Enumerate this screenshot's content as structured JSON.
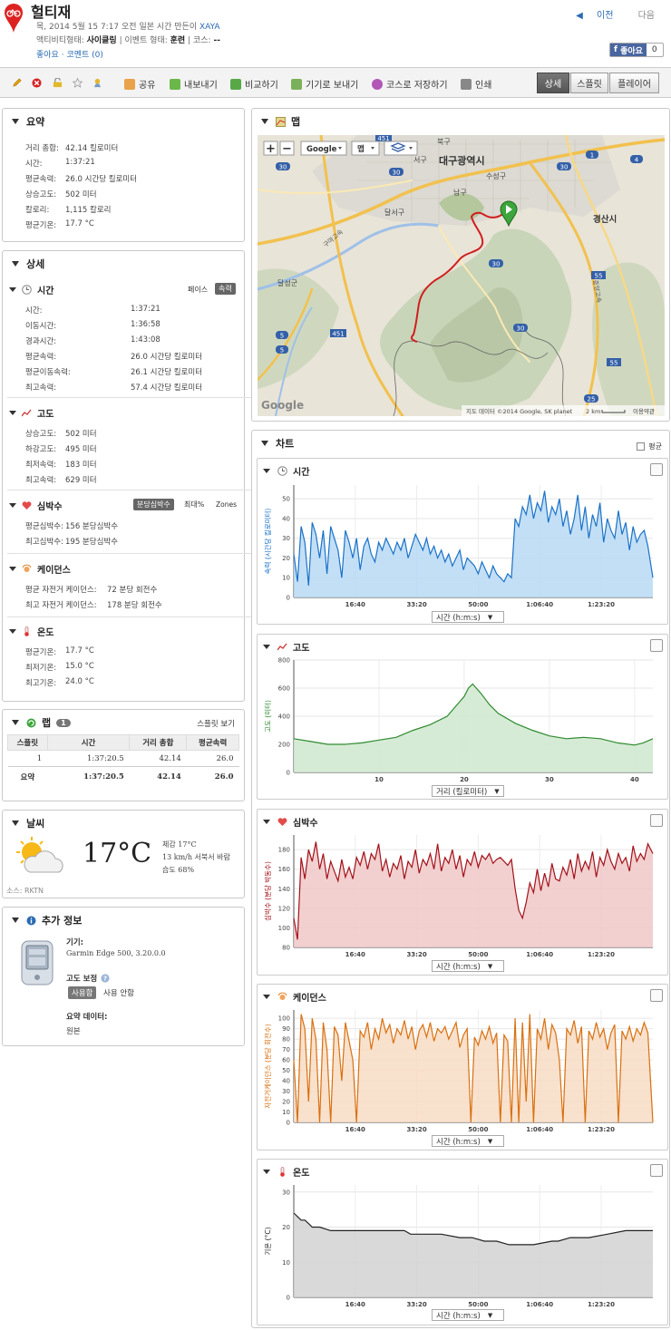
{
  "header": {
    "title": "헐티재",
    "meta_line": "목, 2014 5월 15 7:17 오전 일본 시간 만든이",
    "author": "XAYA",
    "activity_type_label": "액티비티형태:",
    "activity_type": "사이클링",
    "event_type_label": "이벤트 형태:",
    "event_type": "훈련",
    "course_label": "코스:",
    "course_value": "--",
    "like_link": "좋아요",
    "comment_link": "코멘트 (0)",
    "prev": "이전",
    "next": "다음",
    "fb_like": "좋아요",
    "fb_count": "0"
  },
  "toolbar": {
    "share": "공유",
    "export": "내보내기",
    "compare": "비교하기",
    "send_device": "기기로 보내기",
    "save_course": "코스로 저장하기",
    "print": "인쇄",
    "view_detail": "상세",
    "view_splits": "스플릿",
    "view_player": "플레이어"
  },
  "summary": {
    "title": "요약",
    "rows": [
      {
        "label": "거리 총합:",
        "value": "42.14 킬로미터"
      },
      {
        "label": "시간:",
        "value": "1:37:21"
      },
      {
        "label": "평균속력:",
        "value": "26.0 시간당 킬로미터"
      },
      {
        "label": "상승고도:",
        "value": "502 미터"
      },
      {
        "label": "칼로리:",
        "value": "1,115 칼로리"
      },
      {
        "label": "평균기온:",
        "value": "17.7 °C"
      }
    ]
  },
  "details": {
    "title": "상세",
    "time": {
      "title": "시간",
      "toggle_pace": "페이스",
      "toggle_speed": "속력",
      "rows": [
        {
          "label": "시간:",
          "value": "1:37:21"
        },
        {
          "label": "이동시간:",
          "value": "1:36:58"
        },
        {
          "label": "경과시간:",
          "value": "1:43:08"
        },
        {
          "label": "평균속력:",
          "value": "26.0 시간당 킬로미터"
        },
        {
          "label": "평균이동속력:",
          "value": "26.1 시간당 킬로미터"
        },
        {
          "label": "최고속력:",
          "value": "57.4 시간당 킬로미터"
        }
      ]
    },
    "elevation": {
      "title": "고도",
      "rows": [
        {
          "label": "상승고도:",
          "value": "502 미터"
        },
        {
          "label": "하강고도:",
          "value": "495 미터"
        },
        {
          "label": "최저속력:",
          "value": "183 미터"
        },
        {
          "label": "최고속력:",
          "value": "629 미터"
        }
      ]
    },
    "heart": {
      "title": "심박수",
      "toggle_bpm": "분당심박수",
      "toggle_max": "최대%",
      "toggle_zones": "Zones",
      "rows": [
        {
          "label": "평균심박수:",
          "value": "156 분당심박수"
        },
        {
          "label": "최고심박수:",
          "value": "195 분당심박수"
        }
      ]
    },
    "cadence": {
      "title": "케이던스",
      "rows": [
        {
          "label": "평균 자전거 케이던스:",
          "value": "72 분당 회전수"
        },
        {
          "label": "최고 자전거 케이던스:",
          "value": "178 분당 회전수"
        }
      ]
    },
    "temperature": {
      "title": "온도",
      "rows": [
        {
          "label": "평균기온:",
          "value": "17.7 °C"
        },
        {
          "label": "최저기온:",
          "value": "15.0 °C"
        },
        {
          "label": "최고기온:",
          "value": "24.0 °C"
        }
      ]
    }
  },
  "laps": {
    "title": "랩",
    "count": "1",
    "view_splits": "스플릿 보기",
    "headers": [
      "스플릿",
      "시간",
      "거리 총합",
      "평균속력"
    ],
    "rows": [
      [
        "1",
        "1:37:20.5",
        "42.14",
        "26.0"
      ]
    ],
    "summary": [
      "요약",
      "1:37:20.5",
      "42.14",
      "26.0"
    ]
  },
  "weather": {
    "title": "날씨",
    "temp": "17°C",
    "feels": "체감 17°C",
    "wind": "13 km/h 서북서 바람",
    "humidity": "습도 68%",
    "source": "소스: RKTN"
  },
  "extra": {
    "title": "추가 정보",
    "device_label": "기기:",
    "device": "Garmin Edge 500, 3.20.0.0",
    "elev_corr_label": "고도 보정",
    "elev_on": "사용함",
    "elev_off": "사용 안함",
    "summary_data_label": "요약 데이터:",
    "summary_data": "원본"
  },
  "map": {
    "title": "맵",
    "zoom_in": "+",
    "zoom_out": "−",
    "google_btn": "Google",
    "map_btn": "맵",
    "city": "대구광역시",
    "city2": "경산시",
    "labels": [
      "북구",
      "서구",
      "남구",
      "수성구",
      "달서구",
      "달성군",
      "구마고속",
      "중앙고속"
    ],
    "road_numbers": [
      "451",
      "30",
      "30",
      "30",
      "30",
      "5",
      "451",
      "30",
      "55",
      "55",
      "25",
      "4",
      "1",
      "5"
    ],
    "attribution": "지도 데이터 ©2014 Google, SK planet",
    "scale": "2 km",
    "terms": "이용약관",
    "google_logo": "Google"
  },
  "charts": {
    "title": "차트",
    "avg_label": "평균",
    "speed": {
      "title": "시간",
      "select": "시간 (h:m:s)"
    },
    "elevation": {
      "title": "고도",
      "select": "거리 (킬로미터)"
    },
    "heart": {
      "title": "심박수",
      "select": "시간 (h:m:s)"
    },
    "cadence": {
      "title": "케이던스",
      "select": "시간 (h:m:s)"
    },
    "temperature": {
      "title": "온도",
      "select": "시간 (h:m:s)"
    }
  },
  "chart_data": [
    {
      "type": "area",
      "id": "speed",
      "ylabel": "속력 (시간당 킬로미터)",
      "xlabel": "",
      "x_ticks": [
        "16:40",
        "33:20",
        "50:00",
        "1:06:40",
        "1:23:20"
      ],
      "x_tick_values": [
        1000,
        2000,
        3000,
        4000,
        5000
      ],
      "xlim": [
        0,
        5841
      ],
      "ylim": [
        0,
        57
      ],
      "y_ticks": [
        0,
        10,
        20,
        30,
        40,
        50
      ],
      "color": "#1a72c8",
      "fill": "#b9d9f5",
      "x": [
        0,
        60,
        120,
        180,
        240,
        300,
        360,
        420,
        480,
        540,
        600,
        660,
        720,
        780,
        840,
        900,
        960,
        1020,
        1080,
        1140,
        1200,
        1260,
        1320,
        1380,
        1440,
        1500,
        1560,
        1620,
        1680,
        1740,
        1800,
        1860,
        1920,
        1980,
        2040,
        2100,
        2160,
        2220,
        2280,
        2340,
        2400,
        2460,
        2520,
        2580,
        2640,
        2700,
        2760,
        2820,
        2880,
        2940,
        3000,
        3060,
        3120,
        3180,
        3240,
        3300,
        3360,
        3420,
        3480,
        3540,
        3600,
        3660,
        3720,
        3780,
        3840,
        3900,
        3960,
        4020,
        4080,
        4140,
        4200,
        4260,
        4320,
        4380,
        4440,
        4500,
        4560,
        4620,
        4680,
        4740,
        4800,
        4860,
        4920,
        4980,
        5040,
        5100,
        5160,
        5220,
        5280,
        5340,
        5400,
        5460,
        5520,
        5580,
        5640,
        5700,
        5760,
        5841
      ],
      "values": [
        22,
        8,
        36,
        28,
        6,
        38,
        32,
        20,
        34,
        12,
        36,
        30,
        24,
        10,
        34,
        28,
        20,
        30,
        14,
        26,
        30,
        22,
        18,
        28,
        24,
        30,
        26,
        22,
        28,
        24,
        30,
        20,
        26,
        32,
        28,
        24,
        30,
        22,
        26,
        20,
        24,
        18,
        22,
        16,
        20,
        24,
        14,
        20,
        18,
        16,
        12,
        18,
        14,
        10,
        16,
        12,
        10,
        8,
        12,
        10,
        40,
        36,
        46,
        42,
        52,
        40,
        48,
        44,
        54,
        38,
        46,
        42,
        50,
        36,
        44,
        32,
        40,
        52,
        34,
        46,
        30,
        42,
        36,
        48,
        28,
        40,
        34,
        30,
        44,
        32,
        38,
        24,
        36,
        28,
        32,
        34,
        26,
        10
      ]
    },
    {
      "type": "area",
      "id": "elevation",
      "ylabel": "고도 (미터)",
      "xlabel": "",
      "x_ticks": [
        "10",
        "20",
        "30",
        "40"
      ],
      "x_tick_values": [
        10,
        20,
        30,
        40
      ],
      "xlim": [
        0,
        42.14
      ],
      "ylim": [
        0,
        800
      ],
      "y_ticks": [
        0,
        200,
        400,
        600,
        800
      ],
      "color": "#2e8b2e",
      "fill": "#cfe8cf",
      "x": [
        0,
        2,
        4,
        6,
        8,
        10,
        12,
        14,
        16,
        18,
        19,
        20,
        20.5,
        21,
        22,
        23,
        24,
        26,
        28,
        30,
        32,
        34,
        36,
        38,
        40,
        41,
        42.14
      ],
      "values": [
        240,
        220,
        200,
        200,
        210,
        230,
        250,
        300,
        340,
        400,
        470,
        540,
        600,
        629,
        560,
        480,
        420,
        350,
        300,
        260,
        240,
        250,
        240,
        210,
        195,
        210,
        240
      ]
    },
    {
      "type": "area",
      "id": "heart",
      "ylabel": "심박수 (분당 박동수)",
      "xlabel": "",
      "x_ticks": [
        "16:40",
        "33:20",
        "50:00",
        "1:06:40",
        "1:23:20"
      ],
      "x_tick_values": [
        1000,
        2000,
        3000,
        4000,
        5000
      ],
      "xlim": [
        0,
        5841
      ],
      "ylim": [
        80,
        195
      ],
      "y_ticks": [
        80,
        100,
        120,
        140,
        160,
        180
      ],
      "color": "#a3111a",
      "fill": "#f0c8c8",
      "x": [
        0,
        60,
        120,
        180,
        240,
        300,
        360,
        420,
        480,
        540,
        600,
        660,
        720,
        780,
        840,
        900,
        960,
        1020,
        1080,
        1140,
        1200,
        1260,
        1320,
        1380,
        1440,
        1500,
        1560,
        1620,
        1680,
        1740,
        1800,
        1860,
        1920,
        1980,
        2040,
        2100,
        2160,
        2220,
        2280,
        2340,
        2400,
        2460,
        2520,
        2580,
        2640,
        2700,
        2760,
        2820,
        2880,
        2940,
        3000,
        3060,
        3120,
        3180,
        3240,
        3300,
        3360,
        3420,
        3480,
        3540,
        3600,
        3660,
        3720,
        3780,
        3840,
        3900,
        3960,
        4020,
        4080,
        4140,
        4200,
        4260,
        4320,
        4380,
        4440,
        4500,
        4560,
        4620,
        4680,
        4740,
        4800,
        4860,
        4920,
        4980,
        5040,
        5100,
        5160,
        5220,
        5280,
        5340,
        5400,
        5460,
        5520,
        5580,
        5640,
        5700,
        5760,
        5841
      ],
      "values": [
        110,
        88,
        172,
        150,
        180,
        168,
        188,
        160,
        176,
        150,
        168,
        158,
        148,
        170,
        152,
        162,
        150,
        172,
        164,
        178,
        160,
        176,
        170,
        186,
        158,
        170,
        152,
        166,
        160,
        174,
        150,
        168,
        162,
        180,
        156,
        170,
        164,
        176,
        160,
        186,
        158,
        172,
        166,
        180,
        160,
        174,
        152,
        170,
        164,
        178,
        162,
        174,
        170,
        176,
        166,
        170,
        172,
        168,
        164,
        170,
        140,
        118,
        110,
        126,
        146,
        136,
        160,
        138,
        156,
        142,
        166,
        150,
        148,
        162,
        154,
        170,
        150,
        176,
        158,
        168,
        160,
        178,
        152,
        172,
        164,
        180,
        168,
        160,
        176,
        166,
        172,
        158,
        184,
        168,
        176,
        170,
        186,
        176
      ]
    },
    {
      "type": "area",
      "id": "cadence",
      "ylabel": "자전거케이던스 (분당 회전수)",
      "xlabel": "",
      "x_ticks": [
        "16:40",
        "33:20",
        "50:00",
        "1:06:40",
        "1:23:20"
      ],
      "x_tick_values": [
        1000,
        2000,
        3000,
        4000,
        5000
      ],
      "xlim": [
        0,
        5841
      ],
      "ylim": [
        0,
        108
      ],
      "y_ticks": [
        0,
        10,
        20,
        30,
        40,
        50,
        60,
        70,
        80,
        90,
        100
      ],
      "color": "#d9700f",
      "fill": "#f7dcc4",
      "x": [
        0,
        60,
        120,
        180,
        240,
        300,
        360,
        420,
        480,
        540,
        600,
        660,
        720,
        780,
        840,
        900,
        960,
        1020,
        1080,
        1140,
        1200,
        1260,
        1320,
        1380,
        1440,
        1500,
        1560,
        1620,
        1680,
        1740,
        1800,
        1860,
        1920,
        1980,
        2040,
        2100,
        2160,
        2220,
        2280,
        2340,
        2400,
        2460,
        2520,
        2580,
        2640,
        2700,
        2760,
        2820,
        2880,
        2940,
        3000,
        3060,
        3120,
        3180,
        3240,
        3300,
        3360,
        3420,
        3480,
        3540,
        3600,
        3660,
        3720,
        3780,
        3840,
        3900,
        3960,
        4020,
        4080,
        4140,
        4200,
        4260,
        4320,
        4380,
        4440,
        4500,
        4560,
        4620,
        4680,
        4740,
        4800,
        4860,
        4920,
        4980,
        5040,
        5100,
        5160,
        5220,
        5280,
        5340,
        5400,
        5460,
        5520,
        5580,
        5640,
        5700,
        5760,
        5841
      ],
      "values": [
        60,
        0,
        104,
        90,
        20,
        100,
        80,
        0,
        96,
        70,
        0,
        92,
        84,
        40,
        96,
        78,
        60,
        0,
        88,
        82,
        96,
        70,
        90,
        80,
        100,
        86,
        94,
        76,
        90,
        84,
        98,
        80,
        92,
        70,
        88,
        94,
        82,
        96,
        78,
        90,
        86,
        92,
        80,
        88,
        96,
        72,
        84,
        90,
        0,
        82,
        74,
        88,
        80,
        92,
        76,
        86,
        0,
        84,
        78,
        0,
        100,
        0,
        96,
        20,
        104,
        0,
        90,
        80,
        100,
        70,
        94,
        86,
        60,
        0,
        90,
        84,
        98,
        76,
        92,
        0,
        88,
        80,
        96,
        82,
        90,
        70,
        86,
        94,
        0,
        88,
        80,
        92,
        78,
        90,
        84,
        96,
        86,
        0
      ]
    },
    {
      "type": "area",
      "id": "temperature",
      "ylabel": "기온 (°C)",
      "xlabel": "",
      "x_ticks": [
        "16:40",
        "33:20",
        "50:00",
        "1:06:40",
        "1:23:20"
      ],
      "x_tick_values": [
        1000,
        2000,
        3000,
        4000,
        5000
      ],
      "xlim": [
        0,
        5841
      ],
      "ylim": [
        0,
        32
      ],
      "y_ticks": [
        0,
        10,
        20,
        30
      ],
      "color": "#222222",
      "fill": "#d2d2d2",
      "x": [
        0,
        60,
        120,
        180,
        240,
        300,
        420,
        600,
        900,
        1200,
        1500,
        1800,
        1900,
        2100,
        2400,
        2700,
        2900,
        3100,
        3300,
        3500,
        3700,
        3900,
        4200,
        4300,
        4500,
        4800,
        5100,
        5400,
        5700,
        5841
      ],
      "values": [
        24,
        23,
        22,
        22,
        21,
        20,
        20,
        19,
        19,
        19,
        19,
        19,
        18,
        18,
        18,
        17,
        17,
        16,
        16,
        15,
        15,
        15,
        16,
        16,
        17,
        17,
        18,
        19,
        19,
        19
      ]
    }
  ]
}
